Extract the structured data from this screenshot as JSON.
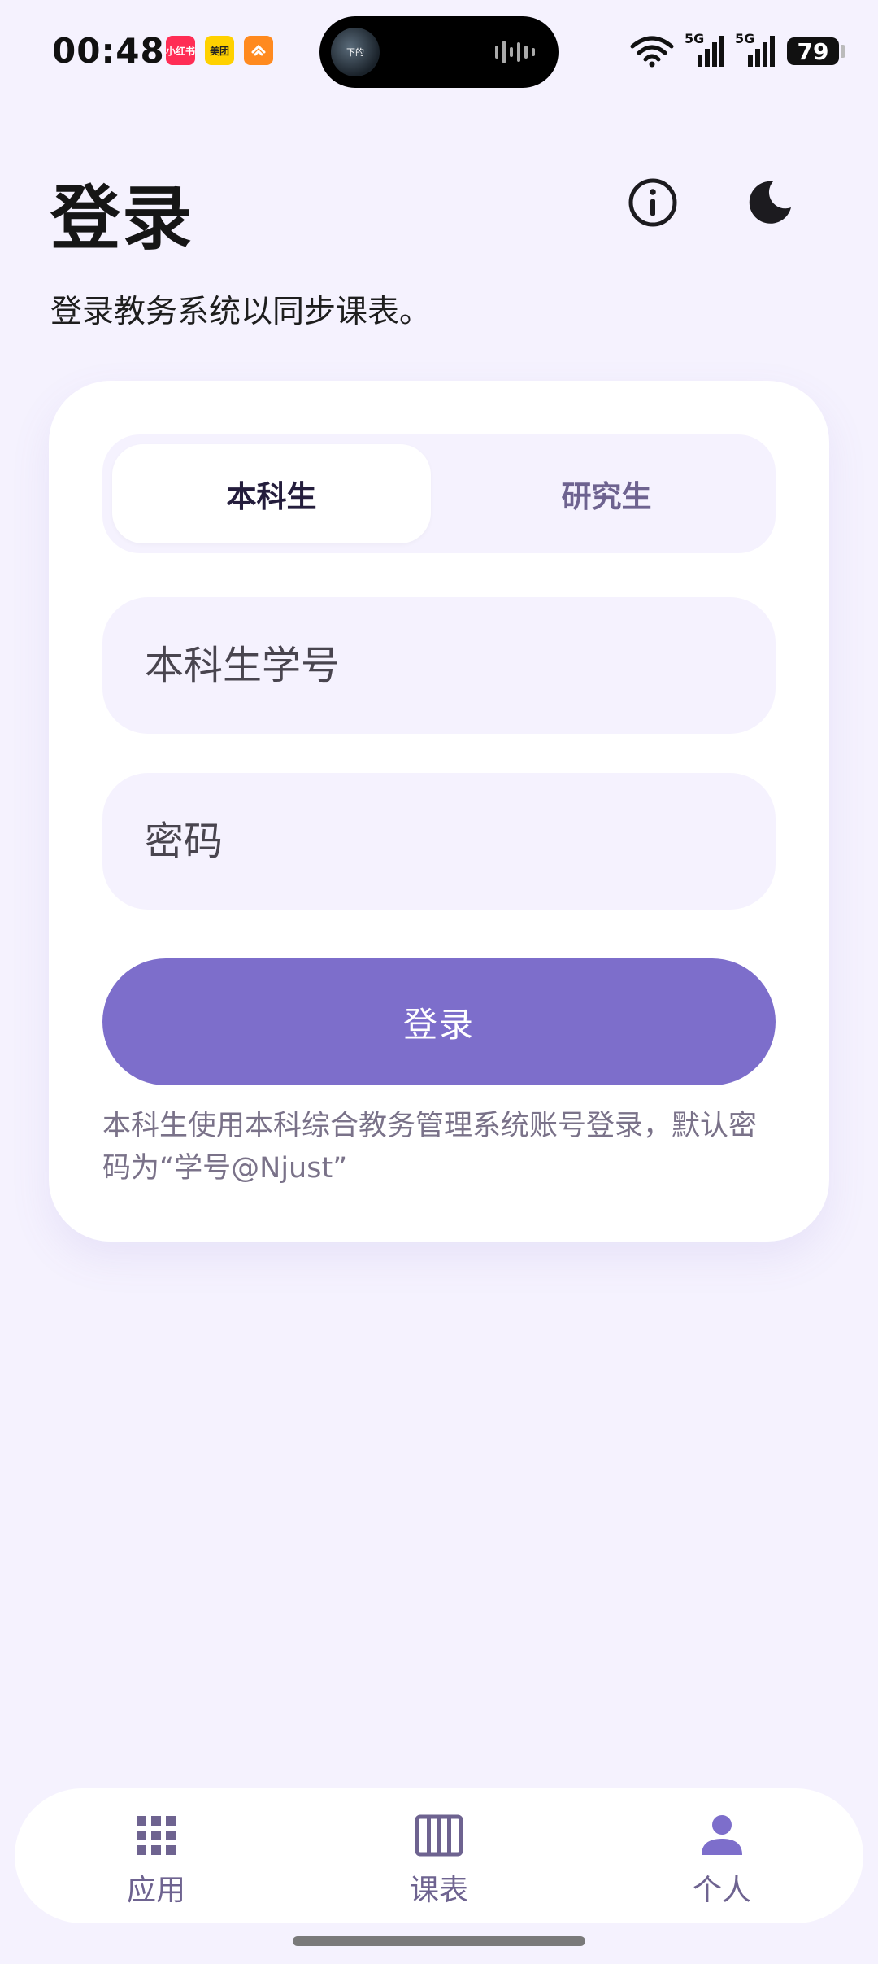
{
  "status_bar": {
    "time": "00:48",
    "badges": [
      "小红书",
      "美团",
      ""
    ],
    "island_art_text": "下的",
    "network": [
      "5G",
      "5G"
    ],
    "battery": "79"
  },
  "header": {
    "title": "登录",
    "subtitle": "登录教务系统以同步课表。"
  },
  "login_card": {
    "tabs": [
      {
        "label": "本科生",
        "active": true
      },
      {
        "label": "研究生",
        "active": false
      }
    ],
    "student_id_placeholder": "本科生学号",
    "password_placeholder": "密码",
    "login_button": "登录",
    "hint": "本科生使用本科综合教务管理系统账号登录，默认密码为“学号@Njust”"
  },
  "bottom_nav": {
    "items": [
      {
        "label": "应用",
        "icon": "grid-icon"
      },
      {
        "label": "课表",
        "icon": "timetable-icon"
      },
      {
        "label": "个人",
        "icon": "person-icon"
      }
    ]
  },
  "colors": {
    "background": "#f5f2fe",
    "accent": "#7d6ecb",
    "nav_inactive": "#6e6390"
  }
}
